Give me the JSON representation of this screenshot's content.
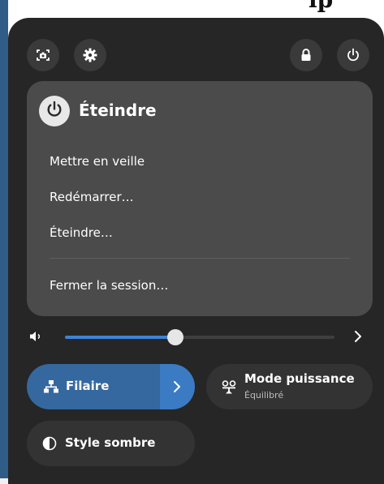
{
  "header_partial": "ıp",
  "top_buttons": {
    "screenshot": "screenshot-icon",
    "settings": "gear-icon",
    "lock": "lock-icon",
    "power": "power-icon"
  },
  "power_menu": {
    "title": "Éteindre",
    "items": [
      {
        "label": "Mettre en veille"
      },
      {
        "label": "Redémarrer…"
      },
      {
        "label": "Éteindre…"
      },
      {
        "label": "Fermer la session…"
      }
    ]
  },
  "volume": {
    "level": 0.41
  },
  "tiles": {
    "wired": {
      "label": "Filaire",
      "icon": "network-wired-icon"
    },
    "power_mode": {
      "label": "Mode puissance",
      "subtitle": "Équilibré",
      "icon": "power-profile-icon"
    },
    "dark_style": {
      "label": "Style sombre",
      "icon": "dark-mode-icon"
    }
  },
  "colors": {
    "accent": "#3e84d6",
    "panel": "#262626",
    "menu": "#4b4b4b"
  }
}
